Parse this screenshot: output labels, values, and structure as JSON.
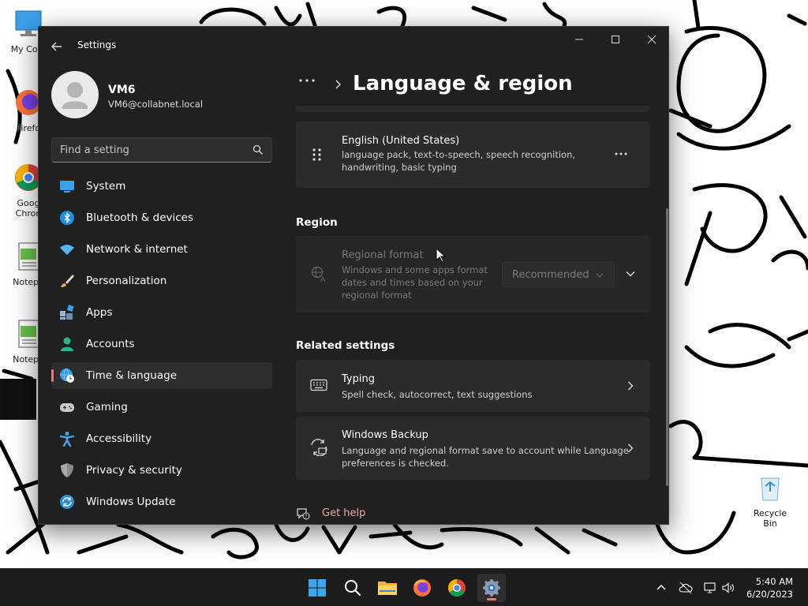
{
  "desktop": {
    "icons": [
      {
        "label": "My Com"
      },
      {
        "label": "Firefo"
      },
      {
        "label": "Goog Chron"
      },
      {
        "label": "Notepa"
      },
      {
        "label": "Notepa"
      }
    ],
    "recycle_bin": {
      "label": "Recycle Bin"
    }
  },
  "window": {
    "title": "Settings",
    "user": {
      "name": "VM6",
      "email": "VM6@collabnet.local"
    },
    "search": {
      "placeholder": "Find a setting"
    },
    "nav": [
      {
        "label": "System",
        "icon": "system-icon",
        "color": "#3aa0e8"
      },
      {
        "label": "Bluetooth & devices",
        "icon": "bluetooth-icon",
        "color": "#1a8fe3"
      },
      {
        "label": "Network & internet",
        "icon": "wifi-icon",
        "color": "#58b4ef"
      },
      {
        "label": "Personalization",
        "icon": "brush-icon",
        "color": "#e6a35a"
      },
      {
        "label": "Apps",
        "icon": "apps-icon",
        "color": "#9ab3d4"
      },
      {
        "label": "Accounts",
        "icon": "person-icon",
        "color": "#28b58c"
      },
      {
        "label": "Time & language",
        "icon": "globe-clock-icon",
        "color": "#3b9be0",
        "active": true
      },
      {
        "label": "Gaming",
        "icon": "gamepad-icon",
        "color": "#c9c9c9"
      },
      {
        "label": "Accessibility",
        "icon": "accessibility-icon",
        "color": "#4aa7e6"
      },
      {
        "label": "Privacy & security",
        "icon": "shield-icon",
        "color": "#a9a9a9"
      },
      {
        "label": "Windows Update",
        "icon": "update-icon",
        "color": "#2b8fd8"
      }
    ],
    "breadcrumb": {
      "title": "Language & region"
    },
    "language_card": {
      "title": "English (United States)",
      "desc_line1": "language pack, text-to-speech, speech recognition,",
      "desc_line2": "handwriting, basic typing"
    },
    "region": {
      "heading": "Region",
      "regional_format": {
        "title": "Regional format",
        "desc_line1": "Windows and some apps format",
        "desc_line2": "dates and times based on your",
        "desc_line3": "regional format",
        "dropdown_value": "Recommended"
      }
    },
    "related": {
      "heading": "Related settings",
      "typing": {
        "title": "Typing",
        "desc": "Spell check, autocorrect, text suggestions"
      },
      "backup": {
        "title": "Windows Backup",
        "desc_line1": "Language and regional format save to account while Language",
        "desc_line2": "preferences is checked."
      }
    },
    "help": {
      "label": "Get help"
    }
  },
  "taskbar": {
    "apps": [
      {
        "name": "start-button"
      },
      {
        "name": "search-button"
      },
      {
        "name": "file-explorer-button"
      },
      {
        "name": "firefox-button"
      },
      {
        "name": "chrome-button"
      },
      {
        "name": "settings-button",
        "active": true
      }
    ],
    "time": "5:40 AM",
    "date": "6/20/2023"
  }
}
